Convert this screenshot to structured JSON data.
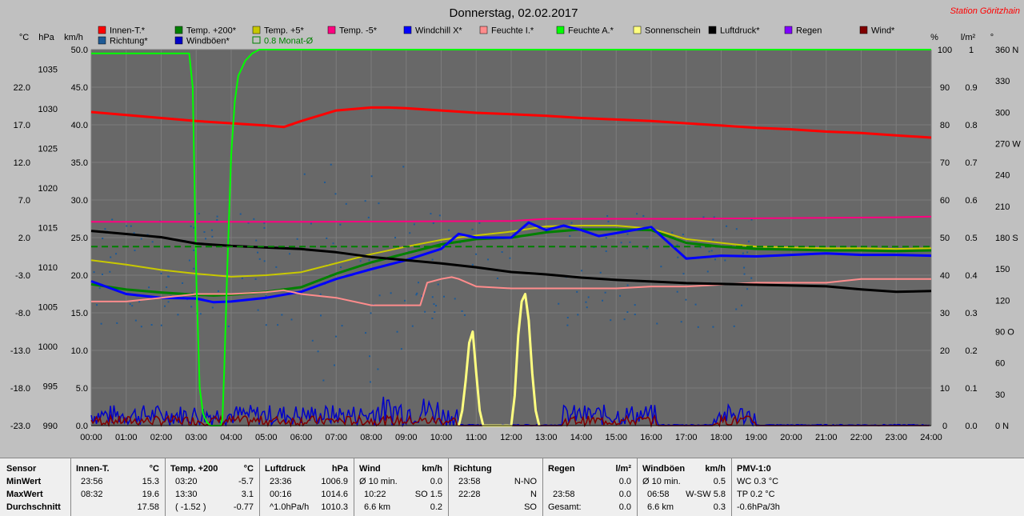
{
  "title": "Donnerstag, 02.02.2017",
  "station": "Station Göritzhain",
  "colors": {
    "plot_bg": "#686868",
    "grid": "#7c7c7c",
    "innen": "#ff0000",
    "temp200": "#008000",
    "temp5": "#c8c800",
    "tempm5": "#ff0080",
    "windchill": "#0000ff",
    "feuchteI": "#ff8c8c",
    "feuchteA": "#00ff00",
    "sonne": "#ffff80",
    "luftdruck": "#000000",
    "regen": "#8000ff",
    "wind": "#800000",
    "richtung": "#1e5a96",
    "windboeen": "#0000c8",
    "monat": "#008000",
    "station": "#ff0000"
  },
  "legend": [
    {
      "label": "Innen-T.*",
      "color": "#ff0000"
    },
    {
      "label": "Temp. +200*",
      "color": "#008000"
    },
    {
      "label": "Temp. +5*",
      "color": "#c8c800"
    },
    {
      "label": "Temp. -5*",
      "color": "#ff0080"
    },
    {
      "label": "Windchill X*",
      "color": "#0000ff"
    },
    {
      "label": "Feuchte I.*",
      "color": "#ff8c8c"
    },
    {
      "label": "Feuchte A.*",
      "color": "#00ff00"
    },
    {
      "label": "Sonnenschein",
      "color": "#ffff80"
    },
    {
      "label": "Luftdruck*",
      "color": "#000000"
    },
    {
      "label": "Regen",
      "color": "#8000ff"
    },
    {
      "label": "Wind*",
      "color": "#800000"
    },
    {
      "label": "Richtung*",
      "color": "#1e5a96"
    },
    {
      "label": "Windböen*",
      "color": "#0000c8"
    },
    {
      "label": "0.8 Monat-Ø",
      "color": "#008000",
      "outline": true
    }
  ],
  "chart_data": {
    "type": "line",
    "title": "Donnerstag, 02.02.2017",
    "units": {
      "temp": "°C",
      "pressure": "hPa",
      "wind": "km/h",
      "humidity": "%",
      "rain": "l/m²",
      "direction": "°"
    },
    "x_ticks": [
      "00:00",
      "01:00",
      "02:00",
      "03:00",
      "04:00",
      "05:00",
      "06:00",
      "07:00",
      "08:00",
      "09:00",
      "10:00",
      "11:00",
      "12:00",
      "13:00",
      "14:00",
      "15:00",
      "16:00",
      "17:00",
      "18:00",
      "19:00",
      "20:00",
      "21:00",
      "22:00",
      "23:00",
      "24:00"
    ],
    "xlim": [
      0,
      24
    ],
    "axes": {
      "temp": {
        "range": [
          -23,
          27
        ],
        "ticks": [
          "22.0",
          "17.0",
          "12.0",
          "7.0",
          "2.0",
          "-3.0",
          "-8.0",
          "-13.0",
          "-18.0",
          "-23.0"
        ],
        "tick_values": [
          22,
          17,
          12,
          7,
          2,
          -3,
          -8,
          -13,
          -18,
          -23
        ]
      },
      "pressure": {
        "range": [
          990,
          1037.5
        ],
        "ticks": [
          "1035",
          "1030",
          "1025",
          "1020",
          "1015",
          "1010",
          "1005",
          "1000",
          "995",
          "990"
        ],
        "tick_values": [
          1035,
          1030,
          1025,
          1020,
          1015,
          1010,
          1005,
          1000,
          995,
          990
        ]
      },
      "wind": {
        "range": [
          0,
          50
        ],
        "ticks": [
          "50.0",
          "45.0",
          "40.0",
          "35.0",
          "30.0",
          "25.0",
          "20.0",
          "15.0",
          "10.0",
          "5.0",
          "0.0"
        ],
        "tick_values": [
          50,
          45,
          40,
          35,
          30,
          25,
          20,
          15,
          10,
          5,
          0
        ]
      },
      "humidity": {
        "range": [
          0,
          100
        ],
        "ticks": [
          "100",
          "90",
          "80",
          "70",
          "60",
          "50",
          "40",
          "30",
          "20",
          "10",
          "0"
        ],
        "tick_values": [
          100,
          90,
          80,
          70,
          60,
          50,
          40,
          30,
          20,
          10,
          0
        ]
      },
      "rain": {
        "range": [
          0,
          1
        ],
        "ticks": [
          "1",
          "0.9",
          "0.8",
          "0.7",
          "0.6",
          "0.5",
          "0.4",
          "0.3",
          "0.2",
          "0.1",
          "0.0"
        ],
        "tick_values": [
          1,
          0.9,
          0.8,
          0.7,
          0.6,
          0.5,
          0.4,
          0.3,
          0.2,
          0.1,
          0
        ]
      },
      "direction": {
        "range": [
          0,
          360
        ],
        "ticks": [
          "360 N",
          "330",
          "300",
          "270 W",
          "240",
          "210",
          "180 S",
          "150",
          "120",
          "90 O",
          "60",
          "30",
          "0 N"
        ],
        "tick_values": [
          360,
          330,
          300,
          270,
          240,
          210,
          180,
          150,
          120,
          90,
          60,
          30,
          0
        ]
      }
    },
    "series": [
      {
        "name": "Innen-T.*",
        "axis": "temp",
        "color": "#ff0000",
        "width": 3,
        "x": [
          0,
          1,
          2,
          3,
          4,
          5,
          5.5,
          6,
          7,
          8,
          8.5,
          9,
          10,
          11,
          12,
          13,
          14,
          15,
          16,
          17,
          18,
          19,
          20,
          21,
          22,
          23,
          24
        ],
        "y": [
          18.7,
          18.3,
          17.9,
          17.5,
          17.2,
          16.9,
          16.7,
          17.5,
          18.9,
          19.3,
          19.3,
          19.2,
          18.9,
          18.6,
          18.4,
          18.2,
          17.9,
          17.7,
          17.5,
          17.2,
          16.9,
          16.6,
          16.4,
          16.1,
          15.9,
          15.6,
          15.3
        ]
      },
      {
        "name": "Temp. -5*",
        "axis": "temp",
        "color": "#ff0080",
        "width": 2,
        "x": [
          0,
          6,
          12,
          13,
          17,
          23,
          24
        ],
        "y": [
          4.1,
          4.1,
          4.2,
          4.5,
          4.5,
          4.7,
          4.8
        ]
      },
      {
        "name": "Temp. +5*",
        "axis": "temp",
        "color": "#c8c800",
        "width": 2,
        "x": [
          0,
          1,
          2,
          3,
          4,
          5,
          6,
          7,
          8,
          9,
          10,
          11,
          12,
          13,
          14,
          15,
          16,
          17,
          18,
          19,
          20,
          21,
          22,
          23,
          24
        ],
        "y": [
          -1.0,
          -1.6,
          -2.3,
          -2.8,
          -3.2,
          -3.0,
          -2.6,
          -1.4,
          -0.2,
          0.8,
          1.7,
          2.3,
          2.8,
          3.5,
          3.6,
          3.6,
          3.2,
          1.8,
          1.3,
          0.8,
          0.7,
          0.6,
          0.6,
          0.5,
          0.6
        ]
      },
      {
        "name": "Temp. +200*",
        "axis": "temp",
        "color": "#008000",
        "width": 3,
        "x": [
          0,
          1,
          2,
          3,
          3.5,
          4,
          5,
          6,
          7,
          8,
          9,
          10,
          11,
          12,
          13,
          14,
          15,
          16,
          17,
          18,
          19,
          20,
          21,
          22,
          23,
          24
        ],
        "y": [
          -4.2,
          -4.9,
          -5.3,
          -5.6,
          -5.7,
          -5.6,
          -5.2,
          -4.6,
          -2.8,
          -1.3,
          -0.1,
          1.1,
          1.8,
          2.0,
          2.7,
          3.1,
          3.1,
          3.0,
          1.3,
          0.8,
          0.5,
          0.4,
          0.3,
          0.3,
          0.2,
          0.3
        ]
      },
      {
        "name": "Windchill X*",
        "axis": "temp",
        "color": "#0000ff",
        "width": 3,
        "x": [
          0,
          1,
          2,
          3,
          3.5,
          4,
          5,
          6,
          7,
          8,
          9,
          10,
          10.5,
          11,
          12,
          12.5,
          13,
          13.5,
          14,
          14.5,
          15,
          16,
          17,
          18,
          19,
          20,
          21,
          22,
          23,
          24
        ],
        "y": [
          -3.8,
          -5.5,
          -6.0,
          -6.1,
          -6.6,
          -6.5,
          -6.0,
          -5.2,
          -3.5,
          -2.2,
          -1.0,
          0.5,
          2.5,
          2.0,
          2.0,
          4.0,
          3.0,
          3.6,
          3.0,
          2.2,
          2.6,
          3.4,
          -0.8,
          -0.4,
          -0.5,
          -0.3,
          -0.1,
          -0.3,
          -0.3,
          -0.4
        ]
      },
      {
        "name": "Feuchte I.*",
        "axis": "humidity",
        "color": "#ff8c8c",
        "width": 2,
        "x": [
          0,
          1,
          2,
          3,
          4,
          5,
          5.5,
          6,
          7,
          8,
          9,
          9.4,
          9.6,
          10,
          10.3,
          10.5,
          11,
          12,
          13,
          14,
          15,
          16,
          17,
          18,
          19,
          20,
          21,
          22,
          23,
          24
        ],
        "y": [
          33,
          33,
          34,
          35,
          35,
          35.5,
          36,
          35,
          34,
          32,
          32,
          32,
          38,
          39,
          39.5,
          39,
          37,
          36.5,
          36.5,
          36.5,
          36.5,
          37,
          37,
          37.5,
          38,
          38,
          38,
          39,
          39,
          39
        ]
      },
      {
        "name": "Feuchte A.*",
        "axis": "humidity",
        "color": "#00ff00",
        "width": 2,
        "x": [
          0,
          2.7,
          2.8,
          2.9,
          3.0,
          3.1,
          3.2,
          3.3,
          3.4,
          3.5,
          3.6,
          3.7,
          3.75,
          3.8,
          3.9,
          4.0,
          4.1,
          4.2,
          4.4,
          4.6,
          4.8,
          5.0,
          6,
          12,
          18,
          24
        ],
        "y": [
          99,
          99,
          99,
          90,
          40,
          10,
          3,
          1,
          0,
          0,
          0,
          0,
          2,
          15,
          45,
          72,
          86,
          93,
          97,
          99,
          100,
          100,
          100,
          100,
          100,
          100
        ]
      },
      {
        "name": "Sonnenschein",
        "axis": "humidity",
        "color": "#ffff80",
        "width": 3,
        "x": [
          10.5,
          10.6,
          10.7,
          10.8,
          10.9,
          11.0,
          11.1,
          11.2,
          12.0,
          12.1,
          12.2,
          12.3,
          12.4,
          12.5,
          12.6,
          12.7,
          12.8
        ],
        "y": [
          0,
          4,
          12,
          22,
          25,
          14,
          4,
          0,
          0,
          8,
          24,
          33,
          35,
          28,
          14,
          4,
          0
        ]
      },
      {
        "name": "Luftdruck*",
        "axis": "pressure",
        "color": "#000000",
        "width": 3,
        "x": [
          0,
          1,
          2,
          3,
          4,
          5,
          6,
          7,
          8,
          9,
          10,
          11,
          12,
          13,
          14,
          15,
          16,
          17,
          18,
          19,
          20,
          21,
          22,
          23,
          24
        ],
        "y": [
          1014.6,
          1014.2,
          1013.8,
          1013.0,
          1012.7,
          1012.5,
          1012.3,
          1011.9,
          1011.3,
          1010.9,
          1010.5,
          1010.0,
          1009.4,
          1009.1,
          1008.7,
          1008.4,
          1008.2,
          1008.0,
          1007.9,
          1007.8,
          1007.7,
          1007.6,
          1007.2,
          1006.9,
          1007.0
        ]
      },
      {
        "name": "0.8 Monat-Ø",
        "axis": "temp",
        "color": "#008000",
        "width": 2,
        "dash": true,
        "x": [
          0,
          24
        ],
        "y": [
          0.8,
          0.8
        ]
      }
    ]
  },
  "stats": {
    "b1": {
      "h": "Sensor",
      "l1": "MinWert",
      "l2": "MaxWert",
      "l3": "Durchschnitt"
    },
    "b2": {
      "h": "Innen-T.",
      "u": "°C",
      "r1a": "23:56",
      "r1b": "15.3",
      "r2a": "08:32",
      "r2b": "19.6",
      "r3a": "",
      "r3b": "17.58"
    },
    "b3": {
      "h": "Temp. +200",
      "u": "°C",
      "r1a": "03:20",
      "r1b": "-5.7",
      "r2a": "13:30",
      "r2b": "3.1",
      "r3a": "( -1.52 )",
      "r3b": "-0.77"
    },
    "b4": {
      "h": "Luftdruck",
      "u": "hPa",
      "r1a": "23:36",
      "r1b": "1006.9",
      "r2a": "00:16",
      "r2b": "1014.6",
      "r3a": "^1.0hPa/h",
      "r3b": "1010.3"
    },
    "b5": {
      "h": "Wind",
      "u": "km/h",
      "r1a": "Ø 10 min.",
      "r1b": "0.0",
      "r2a": "10:22",
      "r2m": "SO 1.5",
      "r2b": "",
      "r3a": "6.6 km",
      "r3b": "0.2"
    },
    "b6": {
      "h": "Richtung",
      "r1a": "23:58",
      "r1b": "N-NO",
      "r2a": "22:28",
      "r2b": "N",
      "r3b": "SO"
    },
    "b7": {
      "h": "Regen",
      "u": "l/m²",
      "r1b": "0.0",
      "r2a": "23:58",
      "r2b": "0.0",
      "r3a": "Gesamt:",
      "r3b": "0.0"
    },
    "b8": {
      "h": "Windböen",
      "u": "km/h",
      "r1a": "Ø 10 min.",
      "r1b": "0.5",
      "r2a": "06:58",
      "r2b": "W-SW 5.8",
      "r3a": "6.6 km",
      "r3b": "0.3"
    },
    "b9": {
      "h": "PMV-1:0",
      "r1": "WC 0.3 °C",
      "r2": "TP 0.2 °C",
      "r3": "-0.6hPa/3h"
    }
  }
}
